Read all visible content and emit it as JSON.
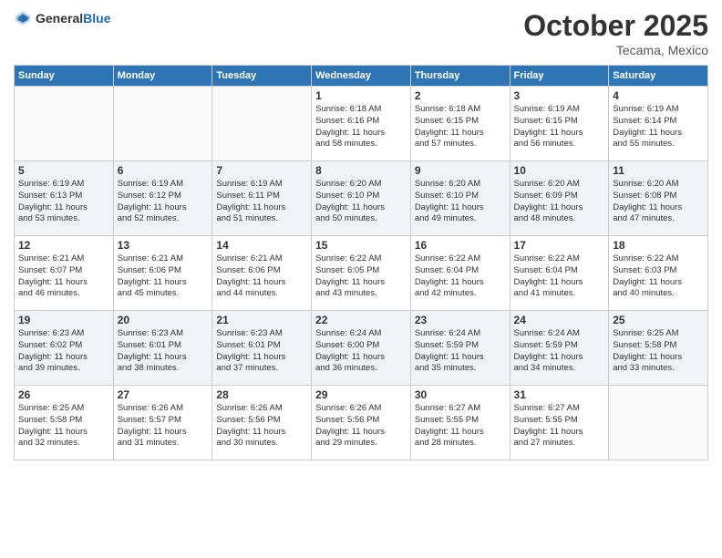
{
  "header": {
    "logo_general": "General",
    "logo_blue": "Blue",
    "month": "October 2025",
    "location": "Tecama, Mexico"
  },
  "weekdays": [
    "Sunday",
    "Monday",
    "Tuesday",
    "Wednesday",
    "Thursday",
    "Friday",
    "Saturday"
  ],
  "weeks": [
    [
      {
        "day": "",
        "info": ""
      },
      {
        "day": "",
        "info": ""
      },
      {
        "day": "",
        "info": ""
      },
      {
        "day": "1",
        "info": "Sunrise: 6:18 AM\nSunset: 6:16 PM\nDaylight: 11 hours\nand 58 minutes."
      },
      {
        "day": "2",
        "info": "Sunrise: 6:18 AM\nSunset: 6:15 PM\nDaylight: 11 hours\nand 57 minutes."
      },
      {
        "day": "3",
        "info": "Sunrise: 6:19 AM\nSunset: 6:15 PM\nDaylight: 11 hours\nand 56 minutes."
      },
      {
        "day": "4",
        "info": "Sunrise: 6:19 AM\nSunset: 6:14 PM\nDaylight: 11 hours\nand 55 minutes."
      }
    ],
    [
      {
        "day": "5",
        "info": "Sunrise: 6:19 AM\nSunset: 6:13 PM\nDaylight: 11 hours\nand 53 minutes."
      },
      {
        "day": "6",
        "info": "Sunrise: 6:19 AM\nSunset: 6:12 PM\nDaylight: 11 hours\nand 52 minutes."
      },
      {
        "day": "7",
        "info": "Sunrise: 6:19 AM\nSunset: 6:11 PM\nDaylight: 11 hours\nand 51 minutes."
      },
      {
        "day": "8",
        "info": "Sunrise: 6:20 AM\nSunset: 6:10 PM\nDaylight: 11 hours\nand 50 minutes."
      },
      {
        "day": "9",
        "info": "Sunrise: 6:20 AM\nSunset: 6:10 PM\nDaylight: 11 hours\nand 49 minutes."
      },
      {
        "day": "10",
        "info": "Sunrise: 6:20 AM\nSunset: 6:09 PM\nDaylight: 11 hours\nand 48 minutes."
      },
      {
        "day": "11",
        "info": "Sunrise: 6:20 AM\nSunset: 6:08 PM\nDaylight: 11 hours\nand 47 minutes."
      }
    ],
    [
      {
        "day": "12",
        "info": "Sunrise: 6:21 AM\nSunset: 6:07 PM\nDaylight: 11 hours\nand 46 minutes."
      },
      {
        "day": "13",
        "info": "Sunrise: 6:21 AM\nSunset: 6:06 PM\nDaylight: 11 hours\nand 45 minutes."
      },
      {
        "day": "14",
        "info": "Sunrise: 6:21 AM\nSunset: 6:06 PM\nDaylight: 11 hours\nand 44 minutes."
      },
      {
        "day": "15",
        "info": "Sunrise: 6:22 AM\nSunset: 6:05 PM\nDaylight: 11 hours\nand 43 minutes."
      },
      {
        "day": "16",
        "info": "Sunrise: 6:22 AM\nSunset: 6:04 PM\nDaylight: 11 hours\nand 42 minutes."
      },
      {
        "day": "17",
        "info": "Sunrise: 6:22 AM\nSunset: 6:04 PM\nDaylight: 11 hours\nand 41 minutes."
      },
      {
        "day": "18",
        "info": "Sunrise: 6:22 AM\nSunset: 6:03 PM\nDaylight: 11 hours\nand 40 minutes."
      }
    ],
    [
      {
        "day": "19",
        "info": "Sunrise: 6:23 AM\nSunset: 6:02 PM\nDaylight: 11 hours\nand 39 minutes."
      },
      {
        "day": "20",
        "info": "Sunrise: 6:23 AM\nSunset: 6:01 PM\nDaylight: 11 hours\nand 38 minutes."
      },
      {
        "day": "21",
        "info": "Sunrise: 6:23 AM\nSunset: 6:01 PM\nDaylight: 11 hours\nand 37 minutes."
      },
      {
        "day": "22",
        "info": "Sunrise: 6:24 AM\nSunset: 6:00 PM\nDaylight: 11 hours\nand 36 minutes."
      },
      {
        "day": "23",
        "info": "Sunrise: 6:24 AM\nSunset: 5:59 PM\nDaylight: 11 hours\nand 35 minutes."
      },
      {
        "day": "24",
        "info": "Sunrise: 6:24 AM\nSunset: 5:59 PM\nDaylight: 11 hours\nand 34 minutes."
      },
      {
        "day": "25",
        "info": "Sunrise: 6:25 AM\nSunset: 5:58 PM\nDaylight: 11 hours\nand 33 minutes."
      }
    ],
    [
      {
        "day": "26",
        "info": "Sunrise: 6:25 AM\nSunset: 5:58 PM\nDaylight: 11 hours\nand 32 minutes."
      },
      {
        "day": "27",
        "info": "Sunrise: 6:26 AM\nSunset: 5:57 PM\nDaylight: 11 hours\nand 31 minutes."
      },
      {
        "day": "28",
        "info": "Sunrise: 6:26 AM\nSunset: 5:56 PM\nDaylight: 11 hours\nand 30 minutes."
      },
      {
        "day": "29",
        "info": "Sunrise: 6:26 AM\nSunset: 5:56 PM\nDaylight: 11 hours\nand 29 minutes."
      },
      {
        "day": "30",
        "info": "Sunrise: 6:27 AM\nSunset: 5:55 PM\nDaylight: 11 hours\nand 28 minutes."
      },
      {
        "day": "31",
        "info": "Sunrise: 6:27 AM\nSunset: 5:55 PM\nDaylight: 11 hours\nand 27 minutes."
      },
      {
        "day": "",
        "info": ""
      }
    ]
  ]
}
